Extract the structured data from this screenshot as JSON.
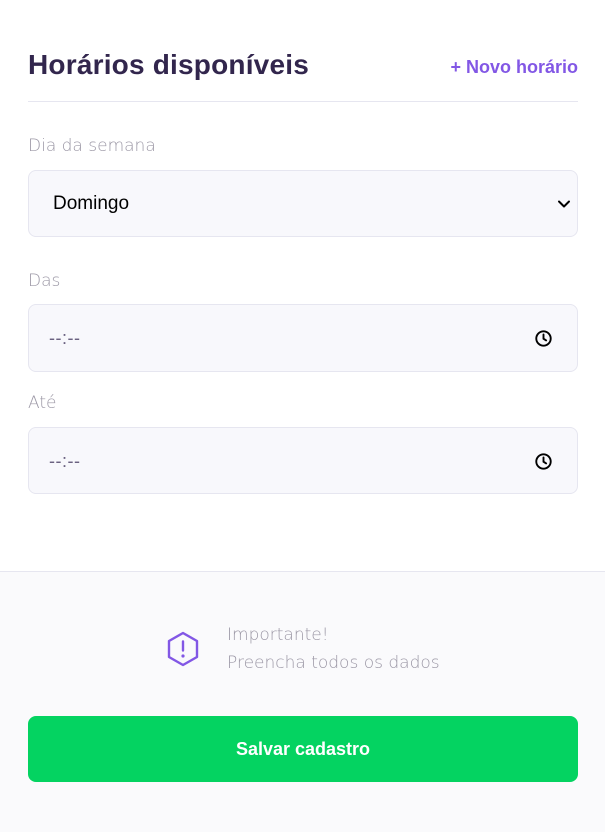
{
  "header": {
    "title": "Horários disponíveis",
    "add_schedule_label": "+ Novo horário"
  },
  "form": {
    "weekday": {
      "label": "Dia da semana",
      "value": "Domingo",
      "icon": "chevron-down-icon"
    },
    "from": {
      "label": "Das",
      "value": "--:--",
      "icon": "clock-icon"
    },
    "to": {
      "label": "Até",
      "value": "--:--",
      "icon": "clock-icon"
    }
  },
  "footer": {
    "notice_title": "Importante!",
    "notice_text": "Preencha todos os dados",
    "notice_icon": "warning-icon",
    "save_label": "Salvar cadastro"
  },
  "colors": {
    "accent": "#8257e5",
    "title": "#32264d",
    "label": "#9c98a6",
    "input_bg": "#f8f8fc",
    "border": "#e6e6f0",
    "button": "#04d361"
  }
}
